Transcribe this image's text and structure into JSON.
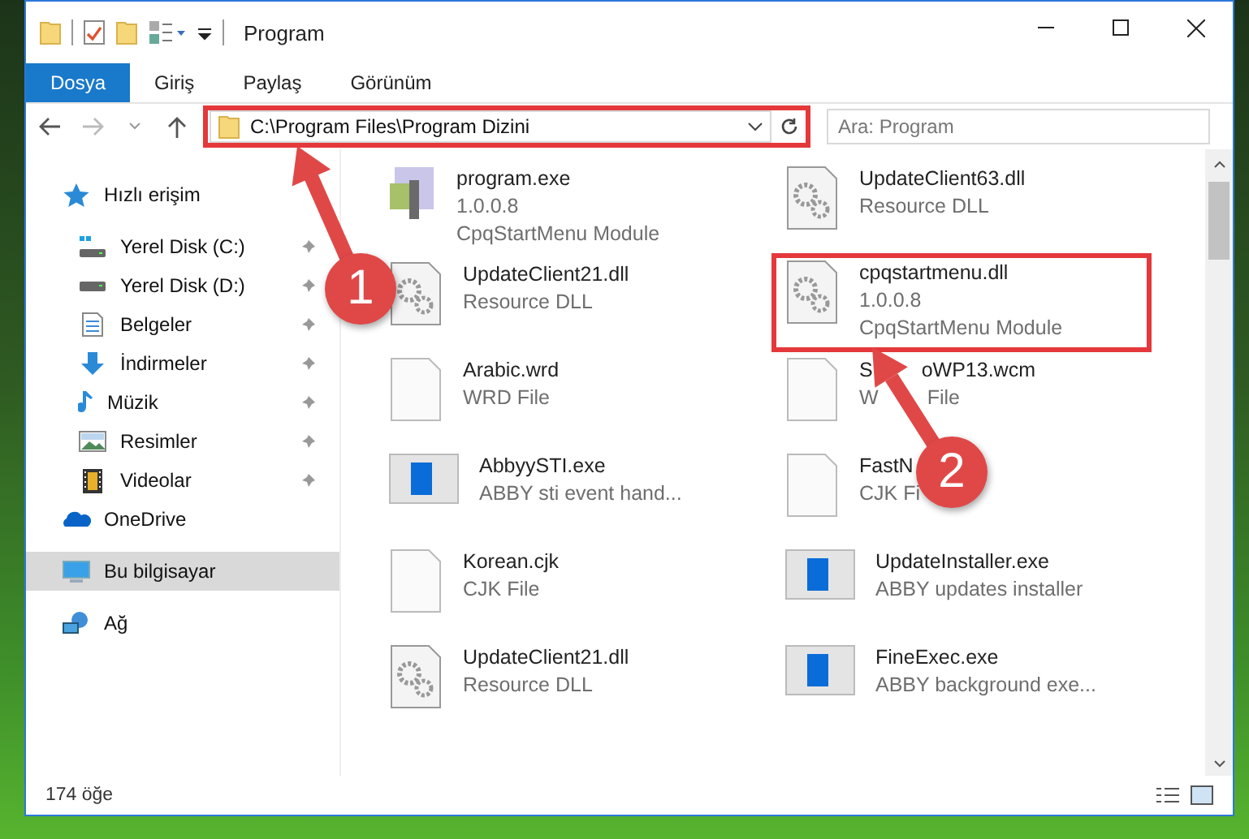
{
  "window": {
    "title": "Program"
  },
  "ribbon_tabs": [
    {
      "label": "Dosya",
      "selected": true
    },
    {
      "label": "Giriş",
      "selected": false
    },
    {
      "label": "Paylaş",
      "selected": false
    },
    {
      "label": "Görünüm",
      "selected": false
    }
  ],
  "address": {
    "path": "C:\\Program Files\\Program Dizini",
    "highlighted": true
  },
  "search": {
    "placeholder": "Ara: Program"
  },
  "sidebar": {
    "items": [
      {
        "label": "Hızlı erişim",
        "kind": "star",
        "selected": false,
        "pinned": false,
        "children": [
          {
            "label": "Yerel Disk (C:)",
            "kind": "drive-c",
            "selected": false,
            "pinned": true
          },
          {
            "label": "Yerel Disk (D:)",
            "kind": "drive",
            "selected": false,
            "pinned": true
          },
          {
            "label": "Belgeler",
            "kind": "docs",
            "selected": false,
            "pinned": true
          },
          {
            "label": "İndirmeler",
            "kind": "download",
            "selected": false,
            "pinned": true
          },
          {
            "label": "Müzik",
            "kind": "music",
            "selected": false,
            "pinned": true
          },
          {
            "label": "Resimler",
            "kind": "pictures",
            "selected": false,
            "pinned": true
          },
          {
            "label": "Videolar",
            "kind": "video",
            "selected": false,
            "pinned": true
          }
        ]
      },
      {
        "label": "OneDrive",
        "kind": "cloud",
        "selected": false,
        "pinned": false
      },
      {
        "label": "Bu bilgisayar",
        "kind": "pc",
        "selected": true,
        "pinned": false
      },
      {
        "label": "Ağ",
        "kind": "network",
        "selected": false,
        "pinned": false
      }
    ]
  },
  "files": [
    {
      "name": "program.exe",
      "details": [
        "1.0.0.8",
        "CpqStartMenu Module"
      ],
      "kind": "exe",
      "highlighted": false
    },
    {
      "name": "UpdateClient63.dll",
      "details": [
        "Resource DLL"
      ],
      "kind": "dll",
      "highlighted": false
    },
    {
      "name": "UpdateClient21.dll",
      "details": [
        "Resource DLL"
      ],
      "kind": "dll",
      "highlighted": false
    },
    {
      "name": "cpqstartmenu.dll",
      "details": [
        "1.0.0.8",
        "CpqStartMenu Module"
      ],
      "kind": "dll",
      "highlighted": true
    },
    {
      "name": "Arabic.wrd",
      "details": [
        "WRD File"
      ],
      "kind": "file",
      "highlighted": false
    },
    {
      "name": [
        "S",
        "oWP13.wcm"
      ],
      "details": [
        [
          "W",
          "File"
        ]
      ],
      "kind": "file",
      "highlighted": false
    },
    {
      "name": "AbbyySTI.exe",
      "details": [
        "ABBY sti event hand..."
      ],
      "kind": "app",
      "highlighted": false
    },
    {
      "name": "FastN",
      "details": [
        "CJK Fi"
      ],
      "kind": "file",
      "highlighted": false
    },
    {
      "name": "Korean.cjk",
      "details": [
        "CJK File"
      ],
      "kind": "file",
      "highlighted": false
    },
    {
      "name": "UpdateInstaller.exe",
      "details": [
        "ABBY updates installer"
      ],
      "kind": "app",
      "highlighted": false
    },
    {
      "name": "UpdateClient21.dll",
      "details": [
        "Resource DLL"
      ],
      "kind": "dll",
      "highlighted": false
    },
    {
      "name": "FineExec.exe",
      "details": [
        "ABBY background exe..."
      ],
      "kind": "app",
      "highlighted": false
    }
  ],
  "status_bar": {
    "count": "174 öğe"
  },
  "annotations": [
    {
      "number": "1"
    },
    {
      "number": "2"
    }
  ]
}
